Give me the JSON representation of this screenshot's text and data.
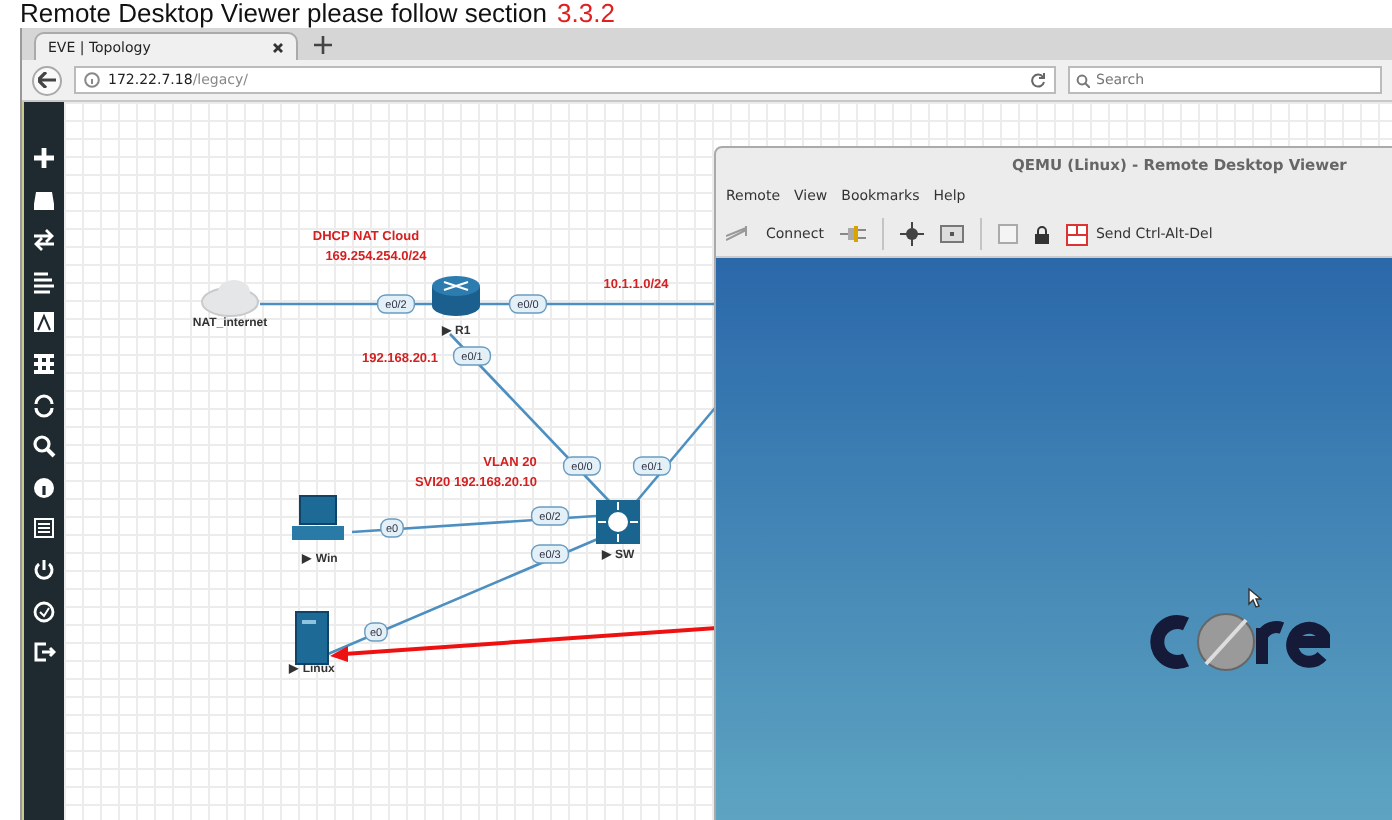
{
  "caption": {
    "text": "Remote Desktop Viewer please follow section",
    "highlight": "3.3.2"
  },
  "browser": {
    "tab": {
      "title": "EVE | Topology",
      "selected": true
    },
    "url": {
      "host": "172.22.7.18",
      "path": "/legacy/"
    },
    "search": {
      "placeholder": "Search"
    }
  },
  "topology": {
    "nodes": [
      {
        "kind": "cloud",
        "label": "NAT_internet"
      },
      {
        "kind": "router",
        "label": "▶ R1"
      },
      {
        "kind": "switch",
        "label": "▶ SW"
      },
      {
        "kind": "pc",
        "label": "▶ Win"
      },
      {
        "kind": "server",
        "label": "▶ Linux"
      }
    ],
    "interfaces": [
      "e0/2",
      "e0/0",
      "e0/1",
      "e0/0",
      "e0/1",
      "e0/2",
      "e0",
      "e0/3",
      "e0"
    ],
    "annotations": [
      "DHCP NAT Cloud",
      "169.254.254.0/24",
      "10.1.1.0/24",
      "192.168.20.1",
      "VLAN 20",
      "SVI20 192.168.20.10"
    ]
  },
  "viewer": {
    "title": "QEMU (Linux) - Remote Desktop Viewer",
    "menu": [
      "Remote",
      "View",
      "Bookmarks",
      "Help"
    ],
    "connect": "Connect",
    "send": "Send Ctrl-Alt-Del"
  }
}
